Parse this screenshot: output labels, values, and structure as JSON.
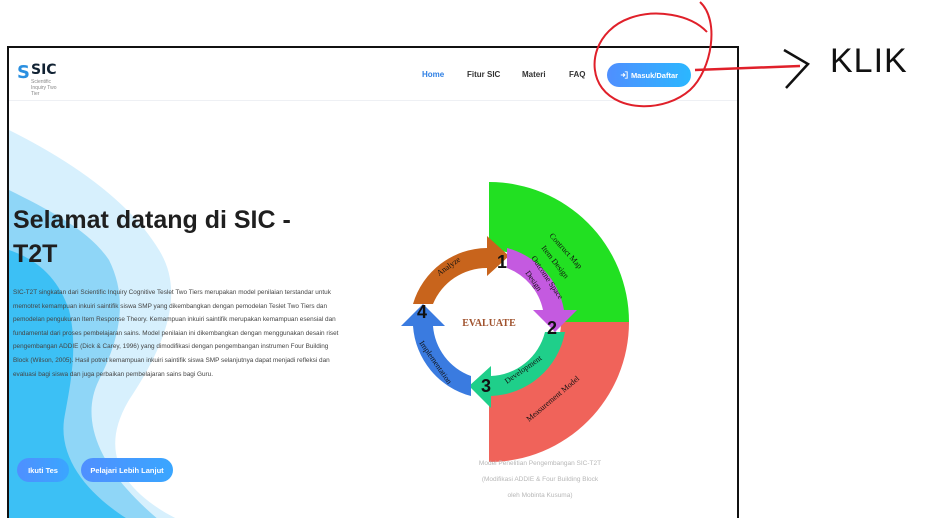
{
  "nav": {
    "logo_text": "SIC",
    "logo_tagline": "Scientific Inquiry Two Tier",
    "items": [
      "Home",
      "Fitur SIC",
      "Materi",
      "FAQ"
    ],
    "active": "Home",
    "cta_label": "Masuk/Daftar",
    "cta_icon": "login-icon"
  },
  "hero": {
    "title": "Selamat datang di SIC - T2T",
    "paragraph": "SIC-T2T singkatan dari Scientific Inquiry Cognitive Teslet Two Tiers merupakan model penilaian terstandar untuk memotret kemampuan inkuiri saintifik siswa SMP yang dikembangkan dengan pemodelan Teslet Two Tiers dan pemodelan pengukuran Item Response Theory. Kemampuan inkuiri saintifik merupakan kemampuan esensial dan fundamental dari proses pembelajaran sains. Model penilaian ini dikembangkan dengan menggunakan desain riset pengembangan ADDIE (Dick & Carey, 1996) yang dimodifikasi dengan pengembangan instrumen Four Building Block (Wilson, 2005). Hasil potret kemampuan inkuiri saintifik siswa SMP selanjutnya dapat menjadi refleksi dan evaluasi bagi siswa dan juga perbaikan pembelajaran sains bagi Guru.",
    "buttons": [
      "Ikuti Tes",
      "Pelajari Lebih Lanjut"
    ]
  },
  "diagram": {
    "center": "EVALUATE",
    "stages": [
      {
        "number": "1",
        "label": "Analyze"
      },
      {
        "number": "2",
        "label": "Design"
      },
      {
        "number": "3",
        "label": "Development"
      },
      {
        "number": "4",
        "label": "Implementation"
      }
    ],
    "blocks": [
      "Contruct Map",
      "Item Design",
      "Outcome Space",
      "Measurement Model"
    ],
    "colors": {
      "analyze": "#c8641c",
      "design": "#c45ae0",
      "development": "#1fcf8a",
      "implementation": "#3a7be0",
      "green_block": "#22e022",
      "red_block": "#f0635a"
    }
  },
  "caption": {
    "line1": "Model Penelitian Pengembangan SIC-T2T",
    "line2": "(Modifikasi ADDIE & Four Building Block",
    "line3": "oleh Mobinta Kusuma)"
  },
  "annotation": {
    "label": "KLIK",
    "color": "#e0202a"
  }
}
